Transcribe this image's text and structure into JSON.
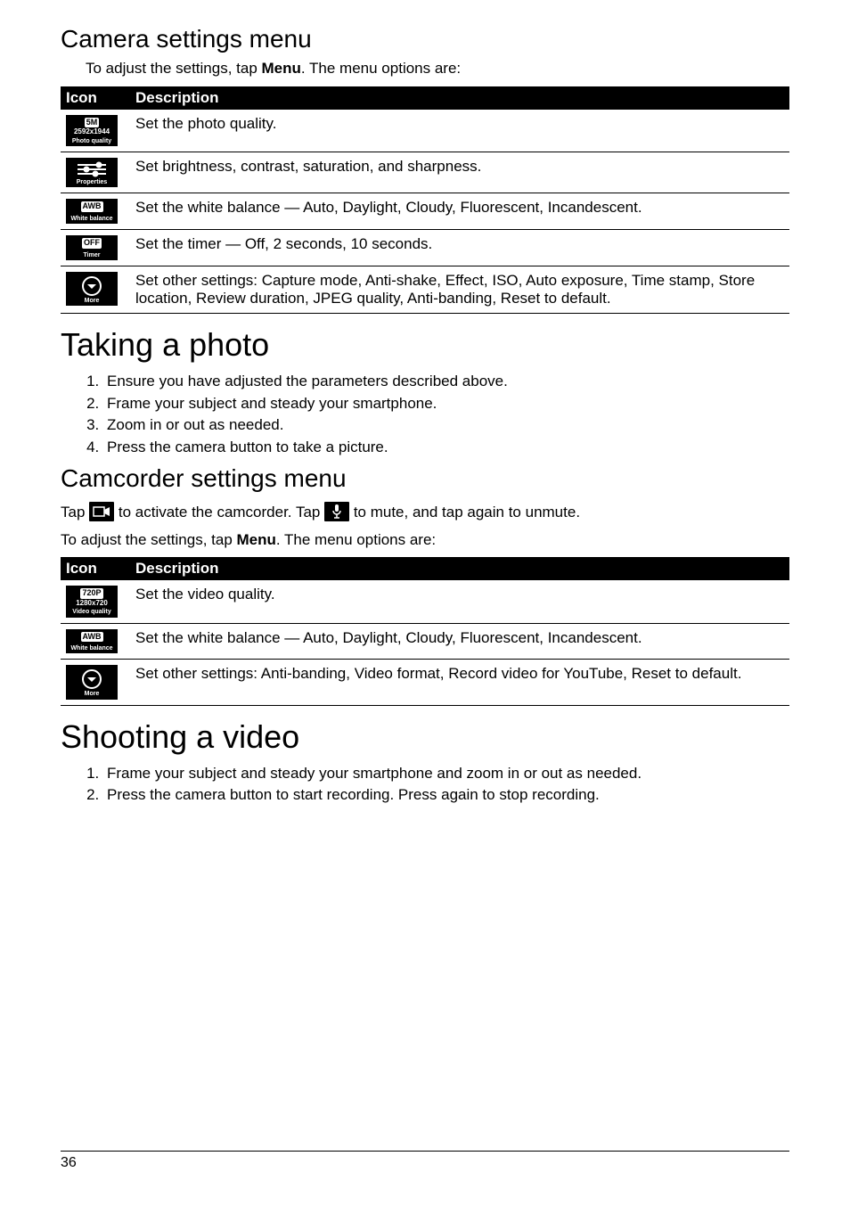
{
  "section1": {
    "heading": "Camera settings menu",
    "intro_pre": "To adjust the settings, tap ",
    "intro_bold": "Menu",
    "intro_post": ". The menu options are:",
    "th_icon": "Icon",
    "th_desc": "Description",
    "rows": [
      {
        "icon_top": "5M",
        "icon_mid": "2592x1944",
        "icon_lbl": "Photo quality",
        "desc": "Set the photo quality."
      },
      {
        "icon_lbl": "Properties",
        "desc": "Set brightness, contrast, saturation, and sharpness."
      },
      {
        "icon_top": "AWB",
        "icon_lbl": "White balance",
        "desc": "Set the white balance — Auto, Daylight, Cloudy, Fluorescent, Incandescent."
      },
      {
        "icon_top": "OFF",
        "icon_lbl": "Timer",
        "desc": "Set the timer — Off, 2 seconds, 10 seconds."
      },
      {
        "icon_lbl": "More",
        "desc": "Set other settings: Capture mode, Anti-shake, Effect, ISO, Auto exposure, Time stamp, Store location, Review duration, JPEG quality, Anti-banding, Reset to default."
      }
    ]
  },
  "section2": {
    "heading": "Taking a photo",
    "steps": [
      "Ensure you have adjusted the parameters described above.",
      "Frame your subject and steady your smartphone.",
      "Zoom in or out as needed.",
      "Press the camera button to take a picture."
    ]
  },
  "section3": {
    "heading": "Camcorder settings menu",
    "line1_a": "Tap ",
    "line1_b": " to activate the camcorder. Tap ",
    "line1_c": " to mute, and tap again to unmute.",
    "line2_pre": "To adjust the settings, tap ",
    "line2_bold": "Menu",
    "line2_post": ". The menu options are:",
    "th_icon": "Icon",
    "th_desc": "Description",
    "rows": [
      {
        "icon_top": "720P",
        "icon_mid": "1280x720",
        "icon_lbl": "Video quality",
        "desc": "Set the video quality."
      },
      {
        "icon_top": "AWB",
        "icon_lbl": "White balance",
        "desc": "Set the white balance — Auto, Daylight, Cloudy, Fluorescent, Incandescent."
      },
      {
        "icon_lbl": "More",
        "desc": "Set other settings: Anti-banding, Video format, Record video for YouTube, Reset to default."
      }
    ]
  },
  "section4": {
    "heading": "Shooting a video",
    "steps": [
      "Frame your subject and steady your smartphone and zoom in or out as needed.",
      "Press the camera button to start recording. Press again to stop recording."
    ]
  },
  "page_number": "36"
}
